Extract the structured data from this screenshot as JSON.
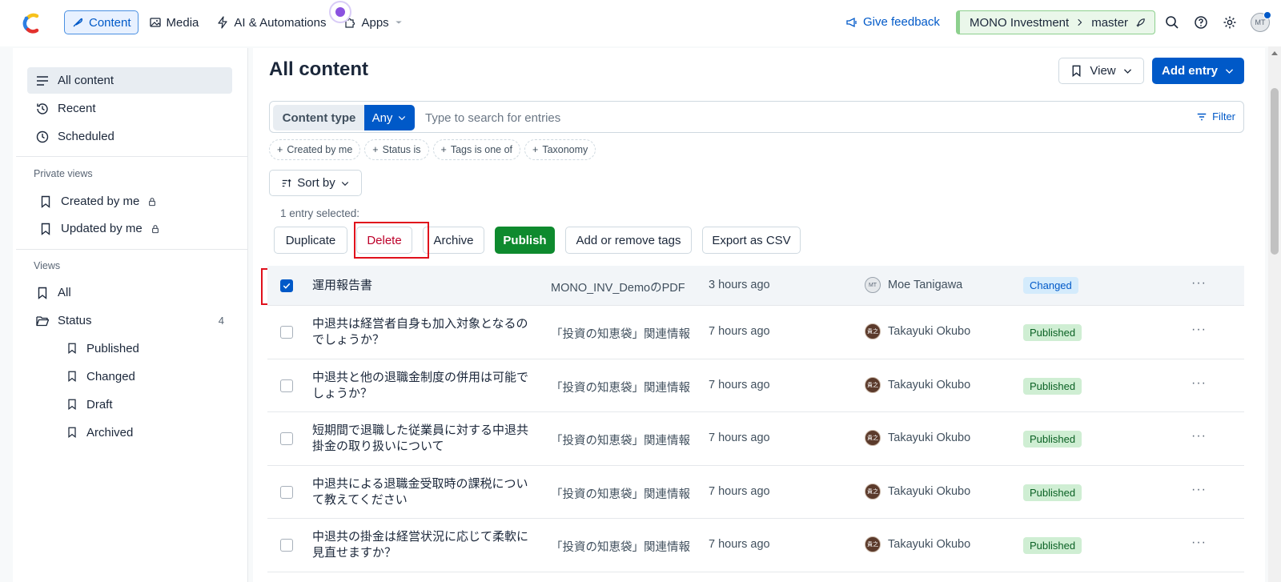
{
  "topbar": {
    "nav": [
      {
        "label": "Content",
        "icon": "feather-pen-icon",
        "active": true
      },
      {
        "label": "Media",
        "icon": "image-icon",
        "active": false
      },
      {
        "label": "AI & Automations",
        "icon": "lightning-icon",
        "active": false
      },
      {
        "label": "Apps",
        "icon": "puzzle-icon",
        "active": false
      }
    ],
    "feedback": "Give feedback",
    "space": "MONO Investment",
    "environment": "master",
    "avatar_initials": "MT"
  },
  "sidebar": {
    "top_items": [
      {
        "label": "All content",
        "active": true
      },
      {
        "label": "Recent"
      },
      {
        "label": "Scheduled"
      }
    ],
    "private_views_title": "Private views",
    "private_views": [
      {
        "label": "Created by me"
      },
      {
        "label": "Updated by me"
      }
    ],
    "views_title": "Views",
    "views": [
      {
        "label": "All"
      },
      {
        "label": "Status",
        "count": "4"
      }
    ],
    "status_views": [
      {
        "label": "Published"
      },
      {
        "label": "Changed"
      },
      {
        "label": "Draft"
      },
      {
        "label": "Archived"
      }
    ]
  },
  "main": {
    "title": "All content",
    "view_button": "View",
    "add_button": "Add entry",
    "content_type_label": "Content type",
    "content_type_value": "Any",
    "search_placeholder": "Type to search for entries",
    "filter_label": "Filter",
    "chips": [
      "Created by me",
      "Status is",
      "Tags is one of",
      "Taxonomy"
    ],
    "sort_label": "Sort by",
    "selected_text": "1 entry selected:",
    "actions": {
      "duplicate": "Duplicate",
      "delete": "Delete",
      "archive": "Archive",
      "publish": "Publish",
      "tags": "Add or remove tags",
      "export": "Export as CSV"
    }
  },
  "entries": [
    {
      "name": "運用報告書",
      "type": "MONO_INV_DemoのPDF",
      "updated": "3 hours ago",
      "author": "Moe Tanigawa",
      "author_initials": "MT",
      "status": "Changed",
      "selected": true
    },
    {
      "name": "中退共は経営者自身も加入対象となるのでしょうか？",
      "type": "「投資の知恵袋」関連情報",
      "updated": "7 hours ago",
      "author": "Takayuki Okubo",
      "author_initials": "貴之",
      "status": "Published",
      "selected": false
    },
    {
      "name": "中退共と他の退職金制度の併用は可能でしょうか？",
      "type": "「投資の知恵袋」関連情報",
      "updated": "7 hours ago",
      "author": "Takayuki Okubo",
      "author_initials": "貴之",
      "status": "Published",
      "selected": false
    },
    {
      "name": "短期間で退職した従業員に対する中退共掛金の取り扱いについて",
      "type": "「投資の知恵袋」関連情報",
      "updated": "7 hours ago",
      "author": "Takayuki Okubo",
      "author_initials": "貴之",
      "status": "Published",
      "selected": false
    },
    {
      "name": "中退共による退職金受取時の課税について教えてください",
      "type": "「投資の知恵袋」関連情報",
      "updated": "7 hours ago",
      "author": "Takayuki Okubo",
      "author_initials": "貴之",
      "status": "Published",
      "selected": false
    },
    {
      "name": "中退共の掛金は経営状況に応じて柔軟に見直せますか？",
      "type": "「投資の知恵袋」関連情報",
      "updated": "7 hours ago",
      "author": "Takayuki Okubo",
      "author_initials": "貴之",
      "status": "Published",
      "selected": false
    }
  ],
  "more_glyph": "···",
  "colors": {
    "primary": "#0059c8",
    "publish": "#0e8a2e",
    "delete": "#bd002a",
    "highlight": "#e0101c",
    "env": "#8dd08e"
  }
}
